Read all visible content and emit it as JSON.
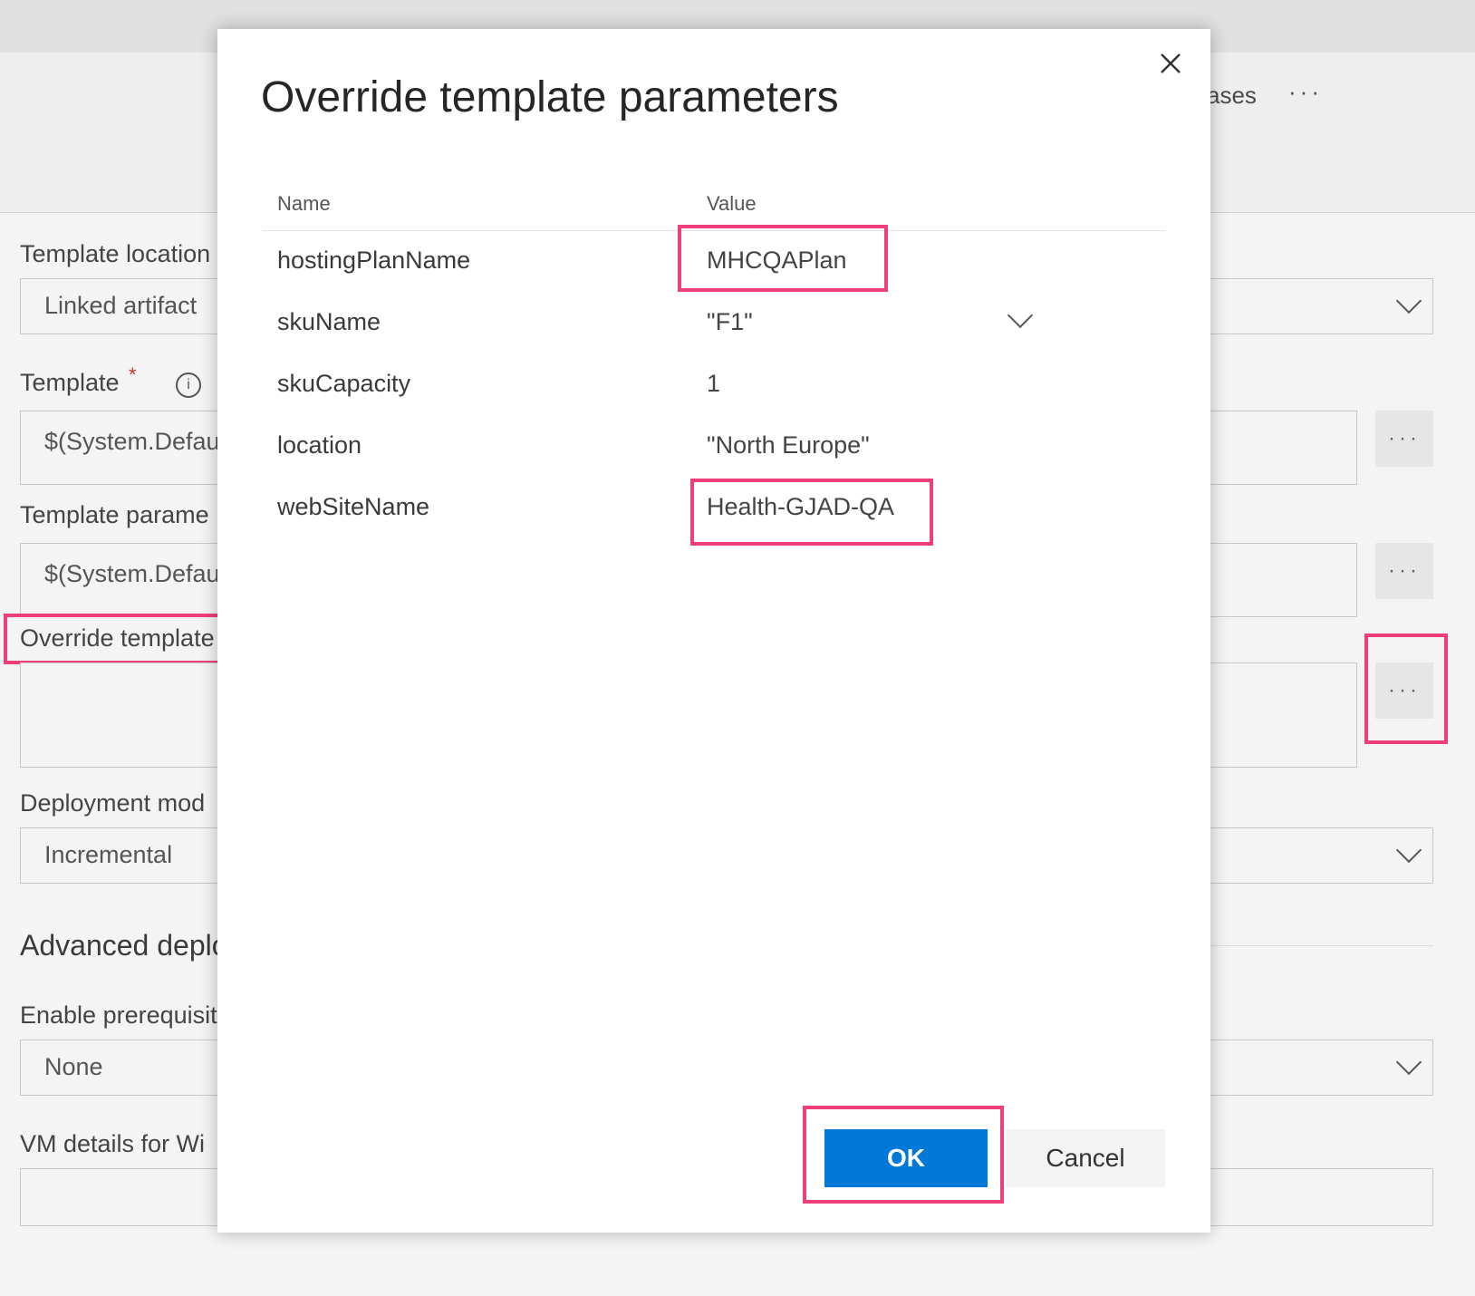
{
  "background": {
    "nav": {
      "partial_tab": "ases",
      "more_label": "···"
    },
    "form": {
      "template_location": {
        "label": "Template location",
        "value": "Linked artifact"
      },
      "template": {
        "label": "Template",
        "required_mark": "*",
        "value": "$(System.Defau"
      },
      "template_parameters": {
        "label": "Template parame",
        "value": "$(System.Defau"
      },
      "override_parameters": {
        "label": "Override template"
      },
      "deployment_mode": {
        "label": "Deployment mod",
        "value": "Incremental"
      },
      "advanced_section": {
        "label": "Advanced deplo"
      },
      "enable_prerequisites": {
        "label": "Enable prerequisit",
        "value": "None"
      },
      "vm_details": {
        "label": "VM details for Wi"
      },
      "ellipsis_label": "···"
    }
  },
  "dialog": {
    "title": "Override template parameters",
    "columns": {
      "name": "Name",
      "value": "Value"
    },
    "rows": [
      {
        "name": "hostingPlanName",
        "value": "MHCQAPlan"
      },
      {
        "name": "skuName",
        "value": "\"F1\""
      },
      {
        "name": "skuCapacity",
        "value": "1"
      },
      {
        "name": "location",
        "value": "\"North Europe\""
      },
      {
        "name": "webSiteName",
        "value": "Health-GJAD-QA"
      }
    ],
    "ok_label": "OK",
    "cancel_label": "Cancel"
  },
  "colors": {
    "accent": "#0078d7",
    "highlight": "#ef3f79"
  }
}
